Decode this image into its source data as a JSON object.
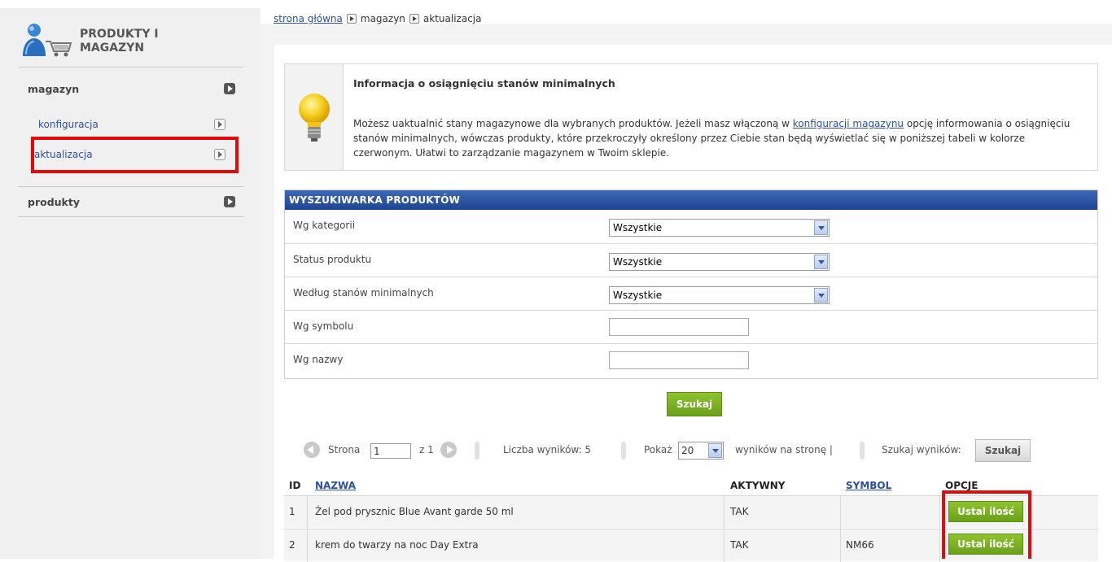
{
  "sidebar": {
    "title_line1": "PRODUKTY I",
    "title_line2": "MAGAZYN",
    "sections": [
      {
        "label": "magazyn"
      },
      {
        "label": "produkty"
      }
    ],
    "subitems": [
      {
        "label": "konfiguracja"
      },
      {
        "label": "aktualizacja"
      }
    ]
  },
  "breadcrumb": {
    "home": "strona główna",
    "level1": "magazyn",
    "level2": "aktualizacja"
  },
  "info": {
    "title": "Informacja o osiągnięciu stanów minimalnych",
    "text_before_link": "Możesz uaktualnić stany magazynowe dla wybranych produktów. Jeżeli masz włączoną w ",
    "link": "konfiguracji magazynu",
    "text_after_link": " opcję informowania o osiągnięciu stanów minimalnych, wówczas produkty, które przekroczyły określony przez Ciebie stan będą wyświetlać się w poniższej tabeli w kolorze czerwonym. Ułatwi to zarządzanie magazynem w Twoim sklepie."
  },
  "search": {
    "header": "WYSZUKIWARKA PRODUKTÓW",
    "rows": [
      {
        "label": "Wg kategorii",
        "value": "Wszystkie"
      },
      {
        "label": "Status produktu",
        "value": "Wszystkie"
      },
      {
        "label": "Według stanów minimalnych",
        "value": "Wszystkie"
      },
      {
        "label": "Wg symbolu",
        "value": ""
      },
      {
        "label": "Wg nazwy",
        "value": ""
      }
    ],
    "button": "Szukaj"
  },
  "pager": {
    "page_label": "Strona",
    "page_value": "1",
    "of_label": "z 1",
    "results_label": "Liczba wyników: 5",
    "show_label": "Pokaż",
    "per_page_value": "20",
    "per_page_suffix": "wyników na stronę |",
    "search_results_label": "Szukaj wyników:",
    "search_button": "Szukaj"
  },
  "table": {
    "headers": {
      "id": "ID",
      "name": "NAZWA",
      "active": "AKTYWNY",
      "symbol": "SYMBOL",
      "options": "OPCJE"
    },
    "rows": [
      {
        "id": "1",
        "name": "Żel pod prysznic Blue Avant garde 50 ml",
        "active": "TAK",
        "symbol": "",
        "action": "Ustal ilość"
      },
      {
        "id": "2",
        "name": "krem do twarzy na noc Day Extra",
        "active": "TAK",
        "symbol": "NM66",
        "action": "Ustal ilość"
      }
    ]
  },
  "colors": {
    "highlight": "#e20b0b",
    "header_blue": "#2a55a5",
    "button_green": "#7cb324",
    "link": "#2a4f9c"
  }
}
